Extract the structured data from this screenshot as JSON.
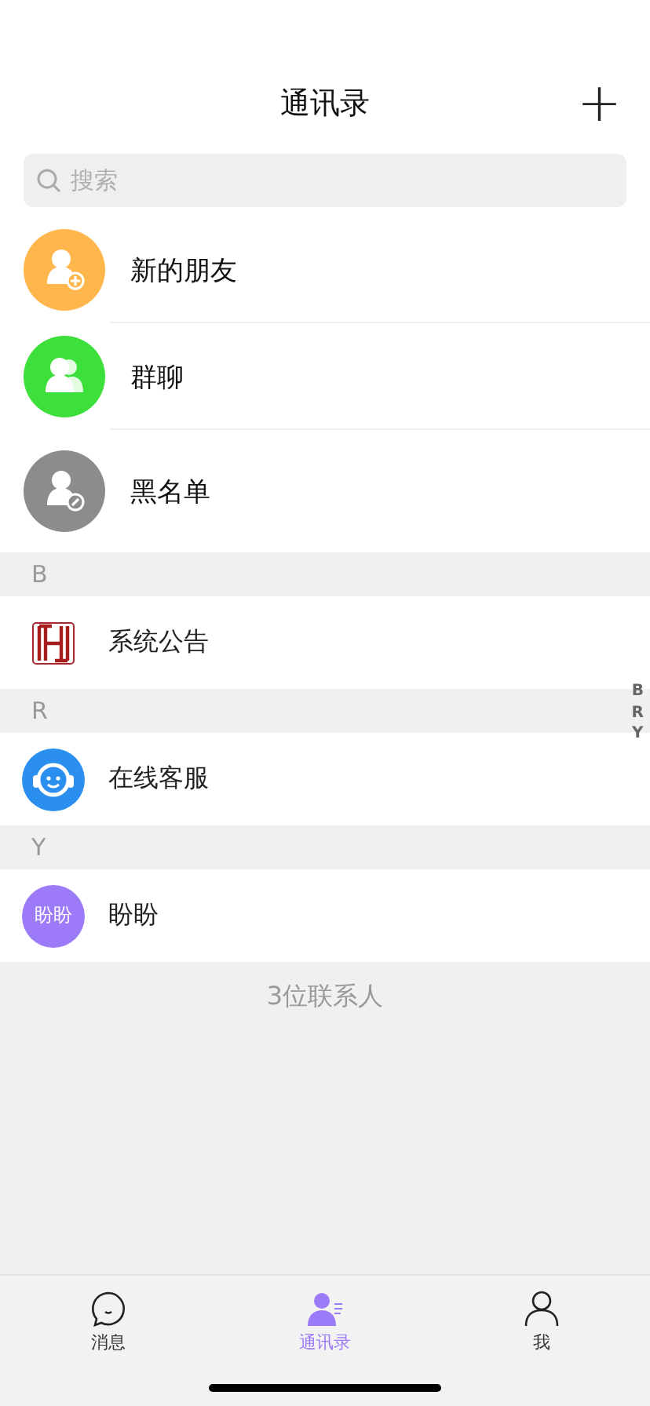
{
  "header": {
    "title": "通讯录",
    "add_button": "+"
  },
  "search": {
    "placeholder": "搜索"
  },
  "shortcuts": [
    {
      "kind": "add",
      "label": "新的朋友",
      "color": "#ffb74d"
    },
    {
      "kind": "group",
      "label": "群聊",
      "color": "#3de03a"
    },
    {
      "kind": "blacklist",
      "label": "黑名单",
      "color": "#8c8c8c"
    }
  ],
  "sections": [
    {
      "letter": "B",
      "contacts": [
        {
          "name": "系统公告",
          "avatar": {
            "kind": "logo"
          }
        }
      ]
    },
    {
      "letter": "R",
      "contacts": [
        {
          "name": "在线客服",
          "avatar": {
            "kind": "service"
          }
        }
      ]
    },
    {
      "letter": "Y",
      "contacts": [
        {
          "name": "盼盼",
          "avatar": {
            "kind": "text",
            "text": "盼盼"
          }
        }
      ]
    }
  ],
  "index_bar": [
    "B",
    "R",
    "Y"
  ],
  "footer_count": "3位联系人",
  "tab_bar": [
    {
      "kind": "chat",
      "label": "消息",
      "selected": false
    },
    {
      "kind": "contacts",
      "label": "通讯录",
      "selected": true
    },
    {
      "kind": "me",
      "label": "我",
      "selected": false
    }
  ]
}
